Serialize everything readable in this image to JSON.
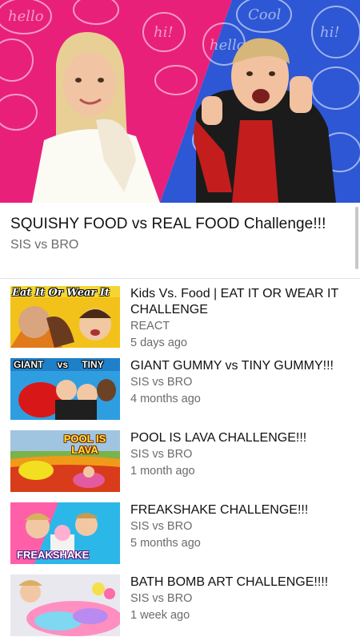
{
  "hero": {
    "title": "SQUISHY FOOD vs REAL FOOD Challenge!!!",
    "channel": "SIS vs BRO",
    "bg_left": "#e8207a",
    "bg_right": "#2a56d6"
  },
  "related": [
    {
      "title": "Kids Vs. Food | EAT IT OR WEAR IT CHALLENGE",
      "channel": "REACT",
      "age": "5 days ago",
      "thumb_text": "Eat It Or Wear It"
    },
    {
      "title": "GIANT GUMMY vs TINY GUMMY!!!",
      "channel": "SIS vs BRO",
      "age": "4 months ago",
      "thumb_text": "GIANT vs TINY"
    },
    {
      "title": "POOL IS LAVA CHALLENGE!!!",
      "channel": "SIS vs BRO",
      "age": "1 month ago",
      "thumb_text": "POOL IS LAVA"
    },
    {
      "title": "FREAKSHAKE CHALLENGE!!!",
      "channel": "SIS vs BRO",
      "age": "5 months ago",
      "thumb_text": "FREAKSHAKE"
    },
    {
      "title": "BATH BOMB ART CHALLENGE!!!!",
      "channel": "SIS vs BRO",
      "age": "1 week ago",
      "thumb_text": ""
    }
  ]
}
